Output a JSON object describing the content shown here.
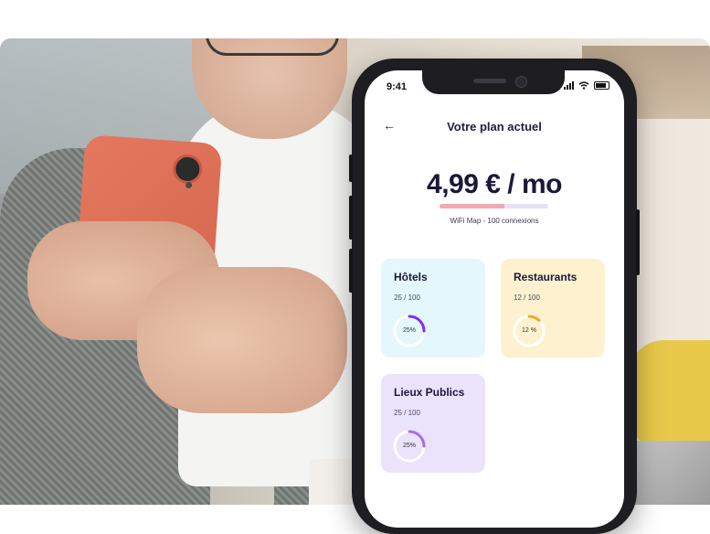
{
  "status_bar": {
    "time": "9:41"
  },
  "header": {
    "back_icon": "arrow-left-icon",
    "title": "Votre plan actuel"
  },
  "plan": {
    "price": "4,99 € / mo",
    "progress": 0.6,
    "description": "WiFi Map - 100 connexions",
    "bar_fill_color": "#f1a9b2",
    "bar_track_color": "#e4e1f7"
  },
  "cards": [
    {
      "title": "Hôtels",
      "count": "25 / 100",
      "percent_label": "25%",
      "percent": 25,
      "bg": "#e3f7fd",
      "ring_color": "#7b2ff7"
    },
    {
      "title": "Restaurants",
      "count": "12 / 100",
      "percent_label": "12 %",
      "percent": 12,
      "bg": "#fdf1cf",
      "ring_color": "#f5a623"
    },
    {
      "title": "Lieux Publics",
      "count": "25 / 100",
      "percent_label": "25%",
      "percent": 25,
      "bg": "#ebe3fb",
      "ring_color": "#a86bec"
    }
  ]
}
